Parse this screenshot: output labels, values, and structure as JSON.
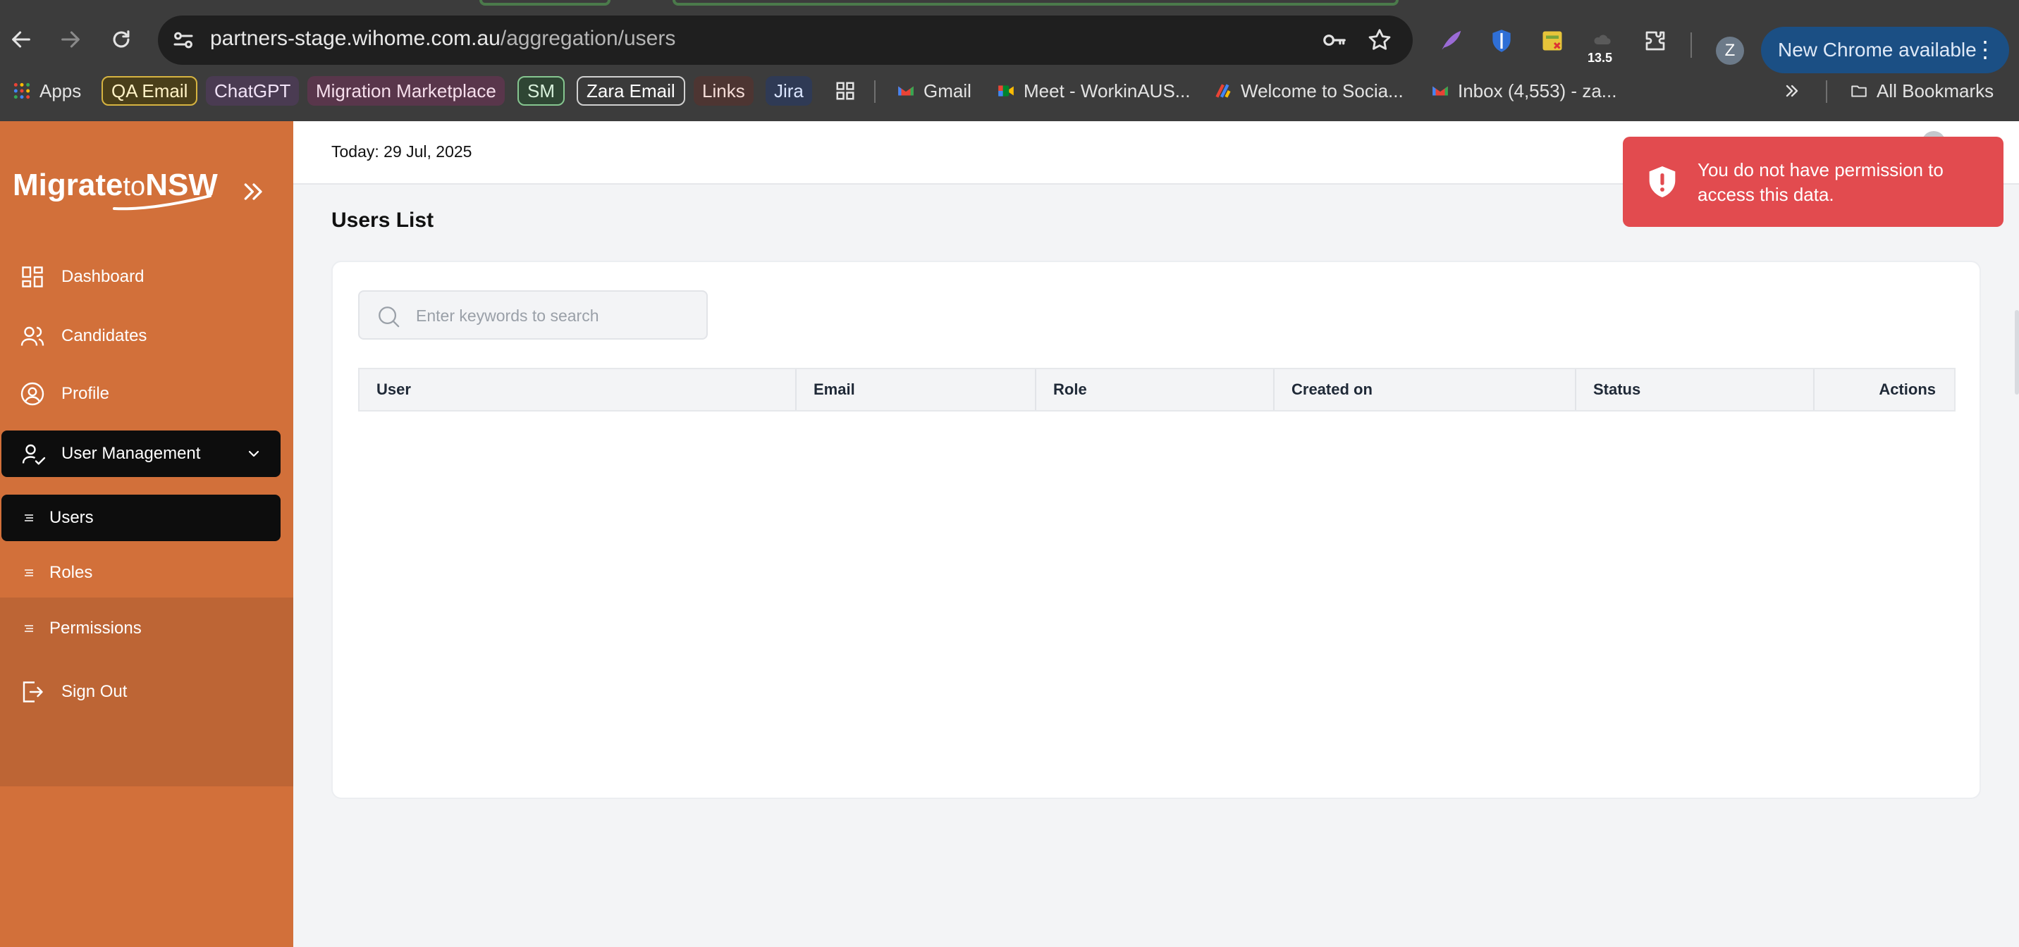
{
  "browser": {
    "url_host": "partners-stage.wihome.com.au",
    "url_path": "/aggregation/users",
    "extension_badge": "13.5",
    "profile_initial": "Z",
    "new_chrome_label": "New Chrome available",
    "bookmarks": {
      "apps": "Apps",
      "qa_email": "QA Email",
      "chatgpt": "ChatGPT",
      "migration_marketplace": "Migration Marketplace",
      "sm": "SM",
      "zara_email": "Zara Email",
      "links": "Links",
      "jira": "Jira",
      "gmail": "Gmail",
      "meet": "Meet - WorkinAUS...",
      "welcome": "Welcome to Socia...",
      "inbox": "Inbox (4,553) - za...",
      "all_bookmarks": "All Bookmarks"
    }
  },
  "app": {
    "logo_main": "Migrate",
    "logo_to": "to",
    "logo_nsw": "NSW",
    "today": "Today: 29 Jul, 2025",
    "nav": {
      "dashboard": "Dashboard",
      "candidates": "Candidates",
      "profile": "Profile",
      "user_management": "User Management",
      "users": "Users",
      "roles": "Roles",
      "permissions": "Permissions",
      "sign_out": "Sign Out"
    },
    "page_title": "Users List",
    "search_placeholder": "Enter keywords to search",
    "columns": [
      "User",
      "Email",
      "Role",
      "Created on",
      "Status",
      "Actions"
    ],
    "toast_message": "You do not have permission to access this data.",
    "colors": {
      "sidebar": "#d2703a",
      "active_nav": "#0d0d0d",
      "toast": "#e24b4f"
    }
  }
}
